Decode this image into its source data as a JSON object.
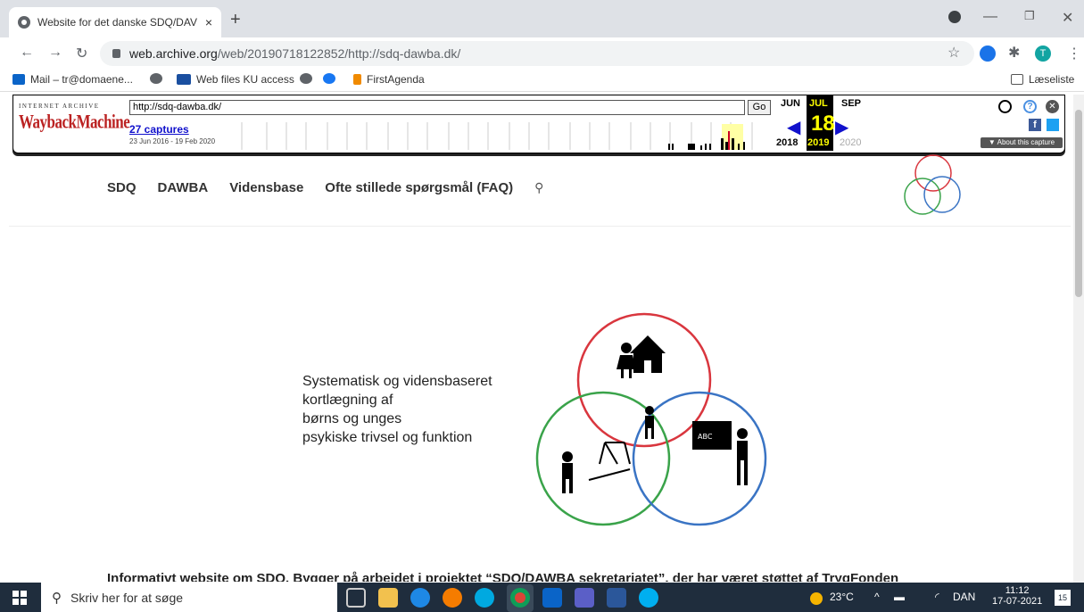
{
  "browser": {
    "tab_title": "Website for det danske SDQ/DAV",
    "tab_close": "×",
    "new_tab": "+",
    "url_host": "web.archive.org",
    "url_path": "/web/20190718122852/http://sdq-dawba.dk/",
    "bookmarks": [
      {
        "label": "Mail – tr@domaene...",
        "color": "#0a64c8"
      },
      {
        "label": "",
        "color": "#5f6368"
      },
      {
        "label": "Web files KU access",
        "color": "#1a4fa0"
      },
      {
        "label": "",
        "color": "#5f6368"
      },
      {
        "label": "",
        "color": "#1877f2"
      },
      {
        "label": "FirstAgenda",
        "color": "#f08a00"
      }
    ],
    "reading_list": "Læseliste",
    "profile_initial": "T"
  },
  "wayback": {
    "logo_small": "INTERNET ARCHIVE",
    "logo_main": "WaybackMachine",
    "url_value": "http://sdq-dawba.dk/",
    "go_label": "Go",
    "captures": "27 captures",
    "range": "23 Jun 2016 - 19 Feb 2020",
    "month_prev": "JUN",
    "month_cur": "JUL",
    "month_next": "SEP",
    "day": "18",
    "year_prev": "2018",
    "year_cur": "2019",
    "year_next": "2020",
    "about": "▼ About this capture"
  },
  "site": {
    "nav": [
      "SDQ",
      "DAWBA",
      "Vidensbase",
      "Ofte stillede spørgsmål (FAQ)"
    ],
    "hero_lines": [
      "Systematisk og vidensbaseret",
      "kortlægning af",
      "børns og unges",
      "psykiske trivsel og funktion"
    ],
    "bottom_text": "Informativt website om SDQ. Bygger på arbejdet i projektet “SDQ/DAWBA sekretariatet”, der har været støttet af TrygFonden",
    "circle_colors": {
      "red": "#d9363e",
      "blue": "#3a74c4",
      "green": "#3aa34a"
    }
  },
  "taskbar": {
    "search_placeholder": "Skriv her for at søge",
    "temperature": "23°C",
    "language": "DAN",
    "time": "11:12",
    "date": "17-07-2021",
    "notifications": "15"
  }
}
